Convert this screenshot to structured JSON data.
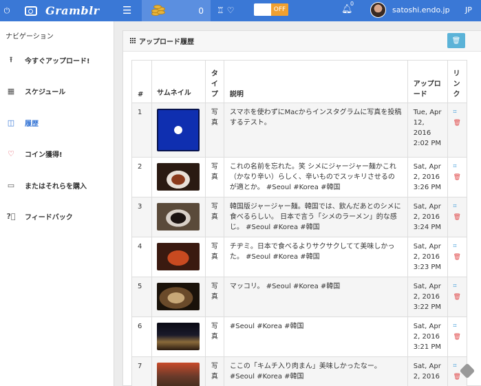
{
  "topbar": {
    "logo": "Gramblr",
    "coin_count": "0",
    "toggle_label": "OFF",
    "bell_badge": "0",
    "username": "satoshi.endo.jp",
    "lang": "JP",
    "colors": {
      "bar": "#3a78d6",
      "coins_bg": "#5b8fe0",
      "toggle": "#f0a030"
    }
  },
  "sidebar": {
    "title": "ナビゲーション",
    "items": [
      {
        "label": "今すぐアップロード!",
        "icon": "upload-icon"
      },
      {
        "label": "スケジュール",
        "icon": "calendar-icon"
      },
      {
        "label": "履歴",
        "icon": "book-icon",
        "active": true
      },
      {
        "label": "コイン獲得!",
        "icon": "heart-icon"
      },
      {
        "label": "またはそれらを購入",
        "icon": "wallet-icon"
      },
      {
        "label": "フィードバック",
        "icon": "question-icon"
      }
    ]
  },
  "panel": {
    "title": "アップロード履歴",
    "columns": {
      "num": "#",
      "thumb": "サムネイル",
      "type": "タイプ",
      "desc": "説明",
      "upload": "アップロード",
      "link": "リンク"
    },
    "rows": [
      {
        "num": "1",
        "type": "写真",
        "desc": "スマホを使わずにMacからインスタグラムに写真を投稿するテスト。",
        "upload": "Tue, Apr 12, 2016 2:02 PM"
      },
      {
        "num": "2",
        "type": "写真",
        "desc": "これの名前を忘れた。笑 シメにジャージャー麺かこれ（かなり辛い）らしく、辛いものでスッキリさせるのが適とか。 #Seoul #Korea #韓国",
        "upload": "Sat, Apr 2, 2016 3:26 PM"
      },
      {
        "num": "3",
        "type": "写真",
        "desc": "韓国版ジャージャー麺。韓国では、飲んだあとのシメに食べるらしい。 日本で言う「シメのラーメン」的な感じ。 #Seoul #Korea #韓国",
        "upload": "Sat, Apr 2, 2016 3:24 PM"
      },
      {
        "num": "4",
        "type": "写真",
        "desc": "チヂミ。日本で食べるよりサクサクしてて美味しかった。 #Seoul #Korea #韓国",
        "upload": "Sat, Apr 2, 2016 3:23 PM"
      },
      {
        "num": "5",
        "type": "写真",
        "desc": "マッコリ。 #Seoul #Korea #韓国",
        "upload": "Sat, Apr 2, 2016 3:22 PM"
      },
      {
        "num": "6",
        "type": "写真",
        "desc": "#Seoul #Korea #韓国",
        "upload": "Sat, Apr 2, 2016 3:21 PM"
      },
      {
        "num": "7",
        "type": "写真",
        "desc": "ここの「キムチ入り肉まん」美味しかったなー。 #Seoul #Korea #韓国",
        "upload": "Sat, Apr 2, 2016"
      }
    ]
  }
}
